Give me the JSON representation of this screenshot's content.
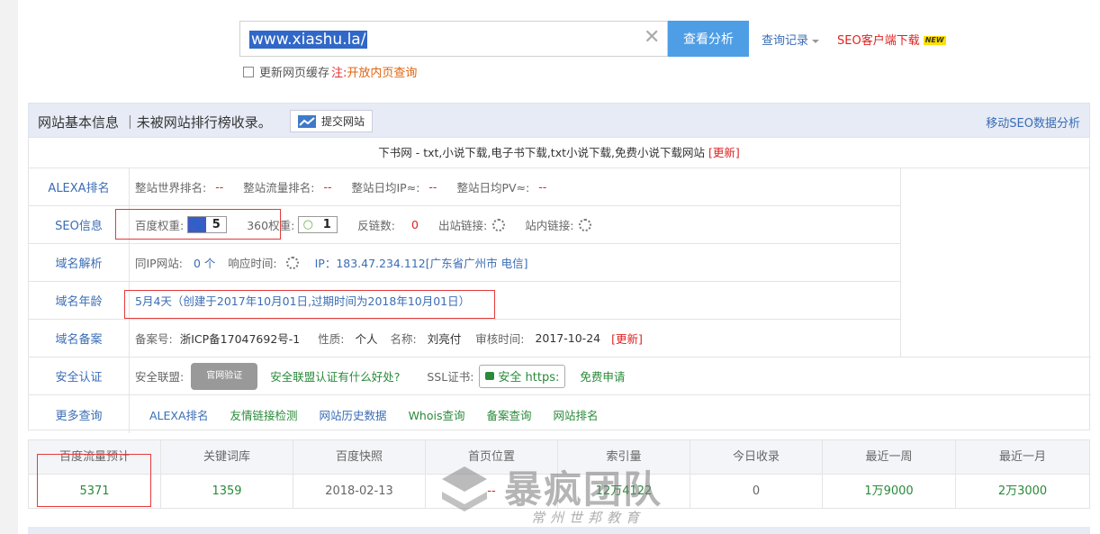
{
  "search": {
    "value": "www.xiashu.la/",
    "clear_icon": "close-icon",
    "button": "查看分析",
    "history": "查询记录",
    "seo_download": "SEO客户端下载",
    "new_badge": "NEW"
  },
  "cache": {
    "label": "更新网页缓存",
    "note_prefix": "注:",
    "note_link": "开放内页查询"
  },
  "info_header": {
    "title": "网站基本信息 ｜未被网站排行榜收录。",
    "submit": "提交网站",
    "mobile": "移动SEO数据分析"
  },
  "site": {
    "title": "下书网 - txt,小说下载,电子书下载,txt小说下载,免费小说下载网站",
    "update": "[更新]"
  },
  "rows": {
    "alexa": {
      "label": "ALEXA排名",
      "world_label": "整站世界排名:",
      "world": "--",
      "traffic_label": "整站流量排名:",
      "traffic": "--",
      "ip_label": "整站日均IP≈:",
      "ip": "--",
      "pv_label": "整站日均PV≈:",
      "pv": "--"
    },
    "seo": {
      "label": "SEO信息",
      "baidu_label": "百度权重:",
      "baidu": "5",
      "so_label": "360权重:",
      "so": "1",
      "backlinks_label": "反链数:",
      "backlinks": "0",
      "outlinks_label": "出站链接:",
      "inlinks_label": "站内链接:"
    },
    "dns": {
      "label": "域名解析",
      "sameip_label": "同IP网站:",
      "sameip": "0 个",
      "resp_label": "响应时间:",
      "ip_text": "IP：183.47.234.112[广东省广州市 电信]"
    },
    "age": {
      "label": "域名年龄",
      "text": "5月4天（创建于2017年10月01日,过期时间为2018年10月01日）"
    },
    "icp": {
      "label": "域名备案",
      "no_label": "备案号:",
      "no": "浙ICP备17047692号-1",
      "nature_label": "性质:",
      "nature": "个人",
      "name_label": "名称:",
      "name": "刘亮付",
      "time_label": "审核时间:",
      "time": "2017-10-24",
      "update": "[更新]"
    },
    "security": {
      "label": "安全认证",
      "union_label": "安全联盟:",
      "seal_text": "官网验证",
      "union_link": "安全联盟认证有什么好处?",
      "ssl_label": "SSL证书:",
      "ssl_badge": "安全 https:",
      "apply": "免费申请"
    },
    "more": {
      "label": "更多查询",
      "links": [
        "ALEXA排名",
        "友情链接检测",
        "网站历史数据",
        "Whois查询",
        "备案查询",
        "网站排名"
      ]
    }
  },
  "stats": {
    "headers": [
      "百度流量预计",
      "关键词库",
      "百度快照",
      "首页位置",
      "索引量",
      "今日收录",
      "最近一周",
      "最近一月"
    ],
    "values": [
      "5371",
      "1359",
      "2018-02-13",
      "--",
      "12万4122",
      "0",
      "1万9000",
      "2万3000"
    ]
  },
  "watermark": {
    "title": "暴疯团队",
    "subtitle": "常州世邦教育"
  }
}
